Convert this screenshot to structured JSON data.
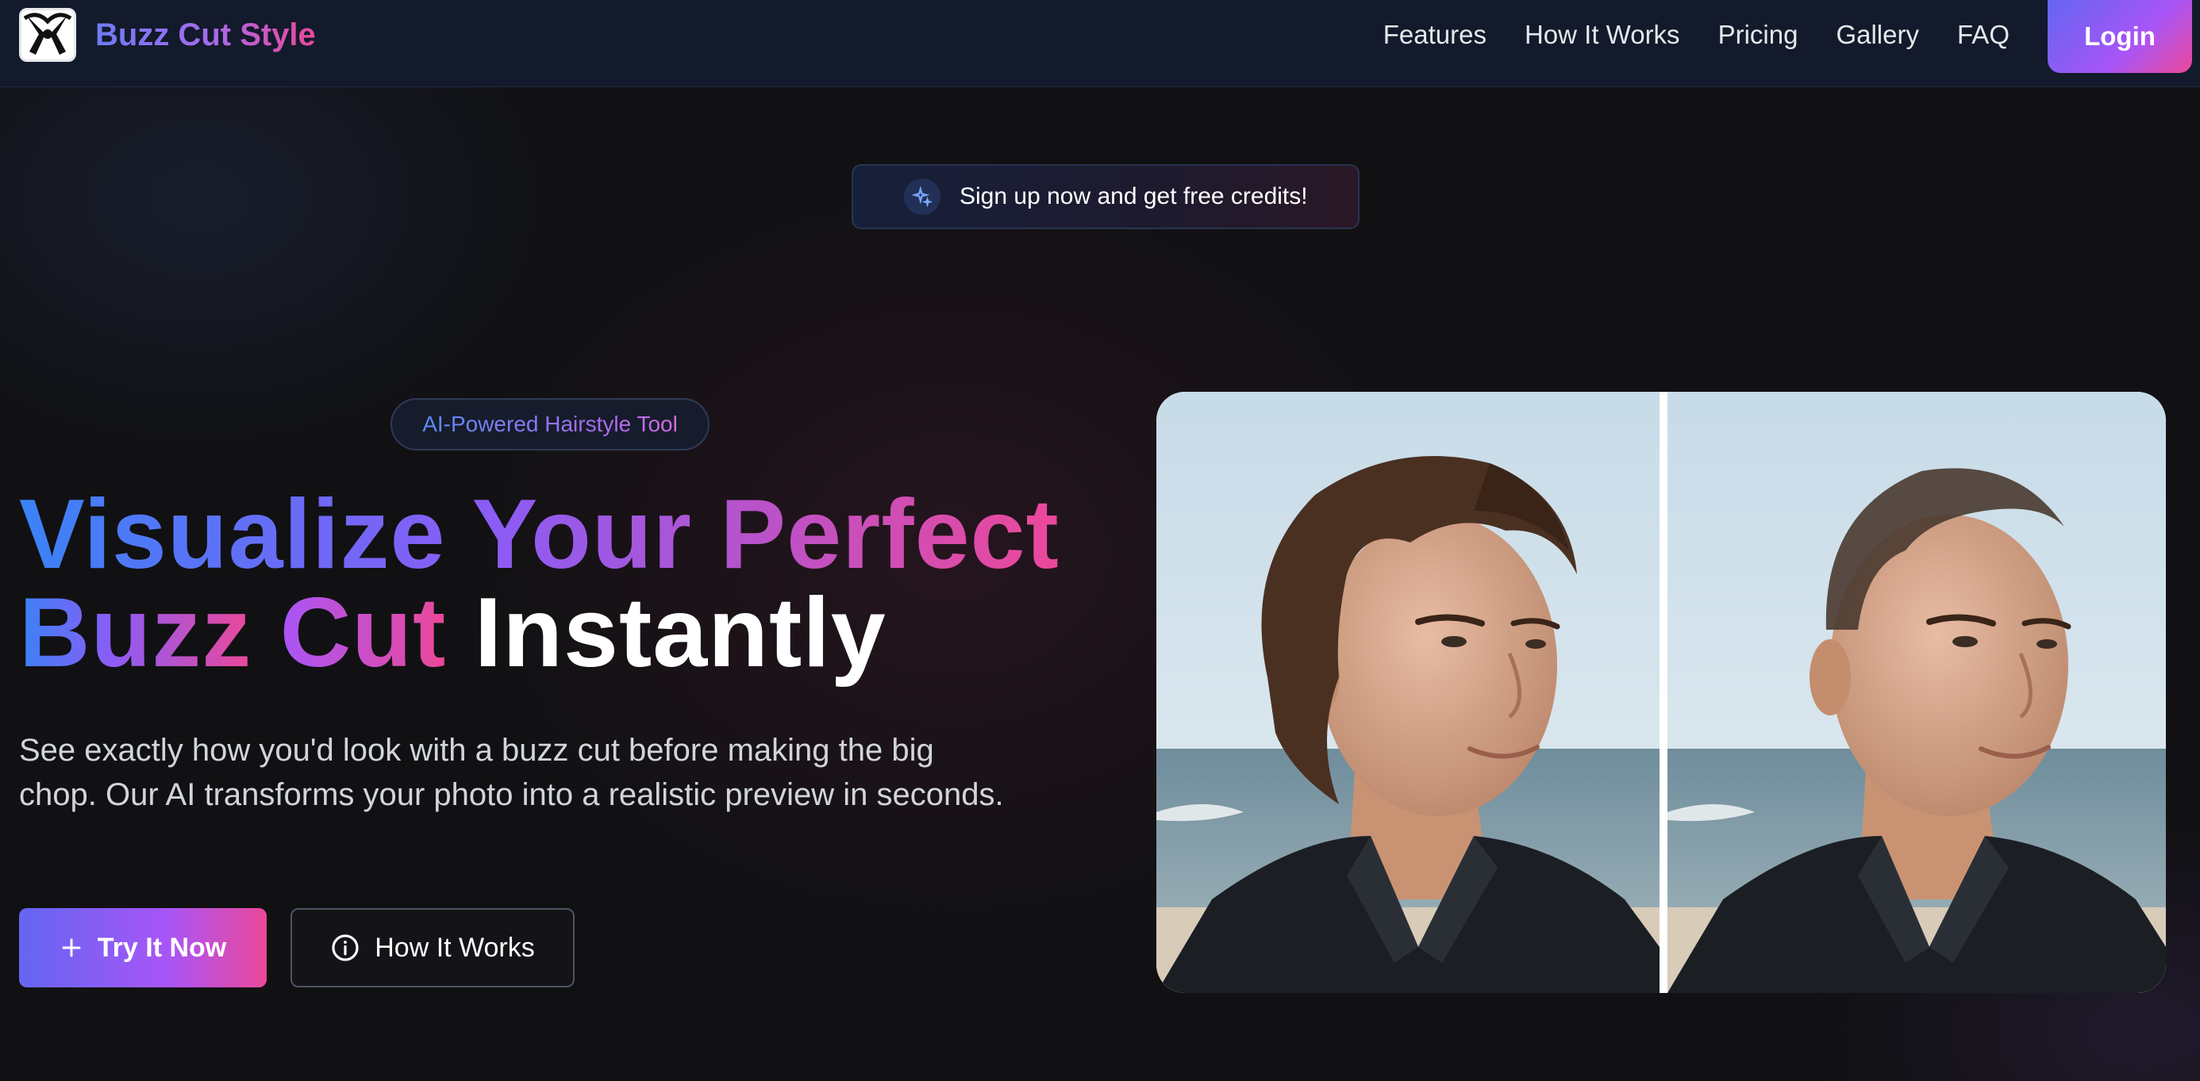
{
  "nav": {
    "brand": "Buzz Cut Style",
    "links": [
      "Features",
      "How It Works",
      "Pricing",
      "Gallery",
      "FAQ"
    ],
    "login_label": "Login"
  },
  "promo": {
    "text": "Sign up now and get free credits!"
  },
  "hero": {
    "badge": "AI-Powered Hairstyle Tool",
    "headline_line1": "Visualize Your Perfect",
    "headline_line2_grad1": "Buzz",
    "headline_line2_grad2": "Cut",
    "headline_line2_plain": "Instantly",
    "subtext_line1": "See exactly how you'd look with a buzz cut before making the big",
    "subtext_line2": "chop. Our AI transforms your photo into a realistic preview in seconds.",
    "primary_cta": "Try It Now",
    "secondary_cta": "How It Works"
  },
  "colors": {
    "background": "#111113",
    "nav_background": "#131a2b",
    "gradient_start": "#3b82f6",
    "gradient_mid": "#8b5cf6",
    "gradient_end": "#ec4899"
  },
  "icons": {
    "logo": "scissors-razor-logo",
    "promo": "sparkles-icon",
    "primary_cta": "plus-icon",
    "secondary_cta": "info-icon"
  }
}
